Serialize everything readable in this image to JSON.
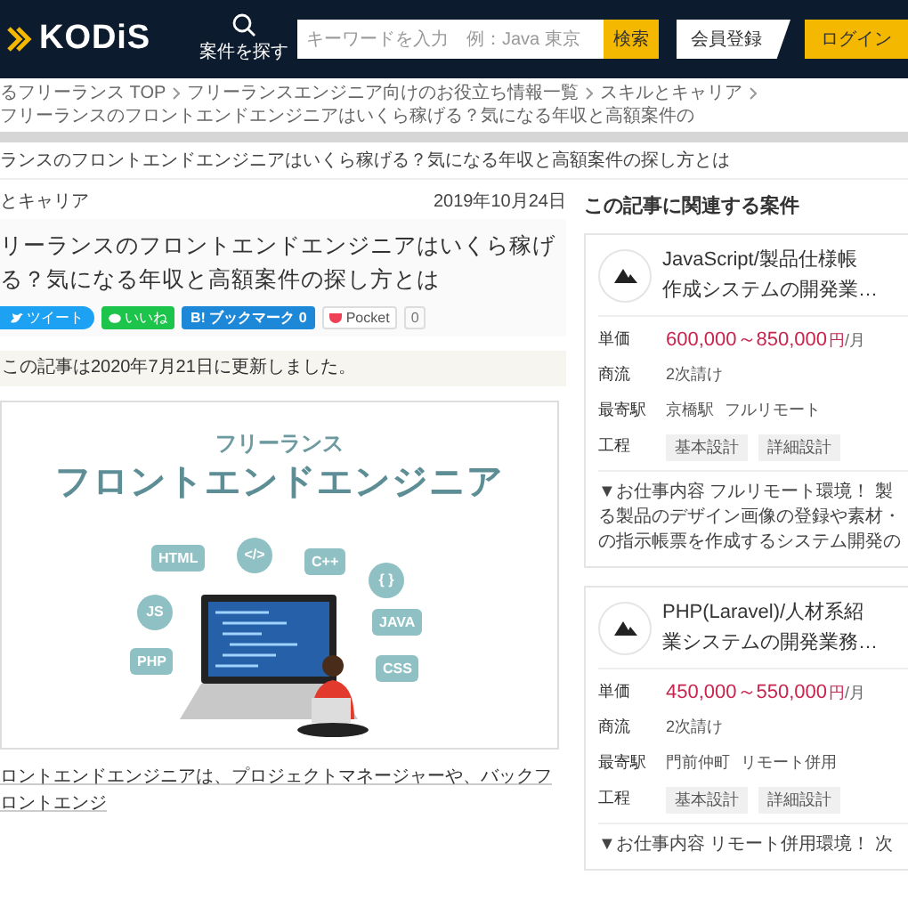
{
  "header": {
    "logo": "KODiS",
    "search_nav": "案件を探す",
    "search": {
      "placeholder": "キーワードを入力　例：Java 東京",
      "button": "検索"
    },
    "register_button": "会員登録",
    "login_button": "ログイン"
  },
  "breadcrumb": [
    "るフリーランス TOP",
    "フリーランスエンジニア向けのお役立ち情報一覧",
    "スキルとキャリア",
    "フリーランスのフロントエンドエンジニアはいくら稼げる？気になる年収と高額案件の"
  ],
  "page_title": "ランスのフロントエンドエンジニアはいくら稼げる？気になる年収と高額案件の探し方とは",
  "article": {
    "category": "とキャリア",
    "date": "2019年10月24日",
    "title": "リーランスのフロントエンドエンジニアはいくら稼げる？気になる年収と高額案件の探し方とは",
    "share_buttons": [
      {
        "kind": "tweet",
        "label": "ツイート"
      },
      {
        "kind": "line",
        "label": "いいね"
      },
      {
        "kind": "hatena",
        "label": "B! ブックマーク 0"
      },
      {
        "kind": "pocket",
        "label": "Pocket",
        "count": "0"
      }
    ],
    "update_notice": "この記事は2020年7月21日に更新しました。",
    "hero_image": {
      "caption_small": "フリーランス",
      "caption_large": "フロントエンドエンジニア",
      "bubbles": [
        {
          "kind": "tag",
          "label": "HTML"
        },
        {
          "kind": "circle",
          "label": "</>"
        },
        {
          "kind": "tag",
          "label": "C++"
        },
        {
          "kind": "circle",
          "label": "{ }"
        },
        {
          "kind": "circle",
          "label": "JS"
        },
        {
          "kind": "tag",
          "label": "JAVA"
        },
        {
          "kind": "tag",
          "label": "PHP"
        },
        {
          "kind": "tag",
          "label": "CSS"
        }
      ]
    },
    "intro": "ロントエンドエンジニアは、プロジェクトマネージャーや、バックフロントエンジ"
  },
  "sidebar": {
    "heading": "この記事に関連する案件",
    "jobs": [
      {
        "title_lines": [
          "JavaScript/製品仕様帳",
          "作成システムの開発業…"
        ],
        "rows": [
          {
            "kind": "price",
            "label": "単価",
            "value": "600,000～850,000",
            "unit": "円",
            "period": "/月"
          },
          {
            "kind": "text",
            "label": "商流",
            "values": [
              "2次請け"
            ]
          },
          {
            "kind": "text",
            "label": "最寄駅",
            "values": [
              "京橋駅",
              "フルリモート"
            ]
          },
          {
            "kind": "tags",
            "label": "工程",
            "values": [
              "基本設計",
              "詳細設計"
            ]
          }
        ],
        "description_lines": [
          "▼お仕事内容 フルリモート環境！ 製",
          "る製品のデザイン画像の登録や素材・",
          "の指示帳票を作成するシステム開発の"
        ]
      },
      {
        "title_lines": [
          "PHP(Laravel)/人材系紹",
          "業システムの開発業務…"
        ],
        "rows": [
          {
            "kind": "price",
            "label": "単価",
            "value": "450,000～550,000",
            "unit": "円",
            "period": "/月"
          },
          {
            "kind": "text",
            "label": "商流",
            "values": [
              "2次請け"
            ]
          },
          {
            "kind": "text",
            "label": "最寄駅",
            "values": [
              "門前仲町",
              "リモート併用"
            ]
          },
          {
            "kind": "tags",
            "label": "工程",
            "values": [
              "基本設計",
              "詳細設計"
            ]
          }
        ],
        "description_lines": [
          "▼お仕事内容 リモート併用環境！ 次"
        ]
      }
    ]
  }
}
